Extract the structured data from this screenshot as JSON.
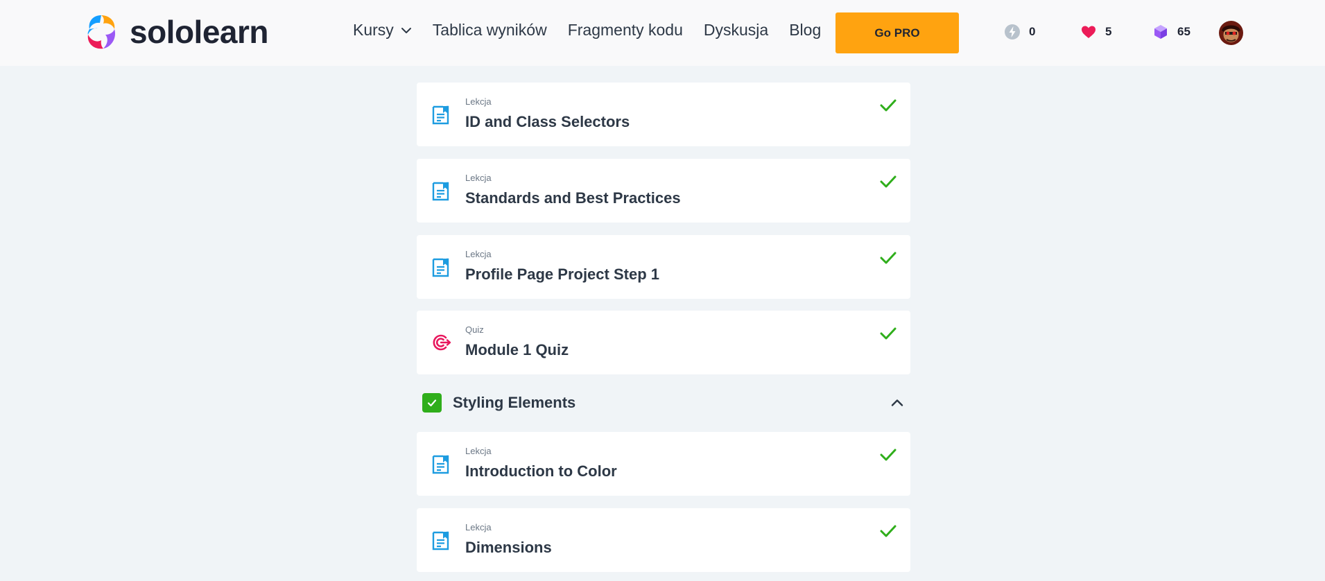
{
  "header": {
    "logo_text": "sololearn",
    "nav": [
      {
        "label": "Kursy",
        "has_dropdown": true
      },
      {
        "label": "Tablica wyników"
      },
      {
        "label": "Fragmenty kodu"
      },
      {
        "label": "Dyskusja"
      },
      {
        "label": "Blog"
      }
    ],
    "go_pro_label": "Go PRO",
    "streak": "0",
    "hearts": "5",
    "bits": "65"
  },
  "lessons_top": [
    {
      "type": "Lekcja",
      "title": "ID and Class Selectors",
      "icon": "lesson-icon",
      "completed": true
    },
    {
      "type": "Lekcja",
      "title": "Standards and Best Practices",
      "icon": "lesson-icon",
      "completed": true
    },
    {
      "type": "Lekcja",
      "title": "Profile Page Project Step 1",
      "icon": "lesson-icon",
      "completed": true
    },
    {
      "type": "Quiz",
      "title": "Module 1 Quiz",
      "icon": "quiz-target-icon",
      "completed": true
    }
  ],
  "section": {
    "title": "Styling Elements",
    "completed": true
  },
  "lessons_bottom": [
    {
      "type": "Lekcja",
      "title": "Introduction to Color",
      "icon": "lesson-icon",
      "completed": true
    },
    {
      "type": "Lekcja",
      "title": "Dimensions",
      "icon": "lesson-icon",
      "completed": true
    }
  ],
  "colors": {
    "accent_orange": "#ffa310",
    "check_green": "#2fae1b",
    "lesson_blue": "#1d9ce0",
    "quiz_pink": "#e8175d",
    "background": "#f0f4f7"
  }
}
